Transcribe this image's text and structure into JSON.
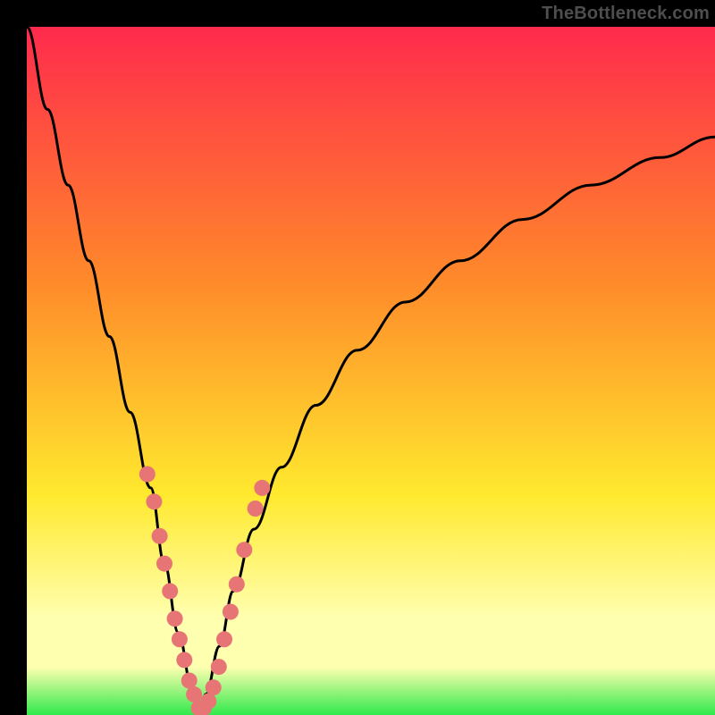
{
  "watermark": "TheBottleneck.com",
  "colors": {
    "frame_bg": "#000000",
    "gradient_top": "#ff2a4d",
    "gradient_mid1": "#ff8a2a",
    "gradient_mid2": "#ffe92e",
    "gradient_pale": "#ffffb0",
    "gradient_bottom": "#2fe94b",
    "curve_stroke": "#000000",
    "marker_fill": "#e77575"
  },
  "chart_data": {
    "type": "line",
    "title": "",
    "xlabel": "",
    "ylabel": "",
    "xlim": [
      0,
      100
    ],
    "ylim": [
      0,
      100
    ],
    "notes": "V-shaped bottleneck curve. y-axis is bottleneck percentage (0 at bottom = no bottleneck, 100 at top). Curve reaches minimum (~0%) near x≈25. Background gradient encodes severity: green near y=0, through yellow/orange, to red near y=100. No numeric axis ticks are shown on the image; values below are estimated from pixel positions.",
    "series": [
      {
        "name": "bottleneck-curve",
        "x": [
          0,
          3,
          6,
          9,
          12,
          15,
          18,
          20,
          22,
          24,
          25,
          26,
          28,
          30,
          33,
          37,
          42,
          48,
          55,
          63,
          72,
          82,
          92,
          100
        ],
        "y": [
          100,
          88,
          77,
          66,
          55,
          44,
          33,
          22,
          12,
          4,
          0,
          3,
          10,
          18,
          27,
          36,
          45,
          53,
          60,
          66,
          72,
          77,
          81,
          84
        ]
      }
    ],
    "markers": {
      "name": "highlighted-points",
      "comment": "Pink dot markers clustered on both arms of the V near the bottom (roughly y ≤ 35%).",
      "points": [
        {
          "x": 17.5,
          "y": 35
        },
        {
          "x": 18.5,
          "y": 31
        },
        {
          "x": 19.3,
          "y": 26
        },
        {
          "x": 20.0,
          "y": 22
        },
        {
          "x": 20.8,
          "y": 18
        },
        {
          "x": 21.5,
          "y": 14
        },
        {
          "x": 22.2,
          "y": 11
        },
        {
          "x": 22.9,
          "y": 8
        },
        {
          "x": 23.6,
          "y": 5
        },
        {
          "x": 24.3,
          "y": 3
        },
        {
          "x": 25.0,
          "y": 1
        },
        {
          "x": 25.7,
          "y": 1
        },
        {
          "x": 26.4,
          "y": 2
        },
        {
          "x": 27.1,
          "y": 4
        },
        {
          "x": 27.9,
          "y": 7
        },
        {
          "x": 28.7,
          "y": 11
        },
        {
          "x": 29.6,
          "y": 15
        },
        {
          "x": 30.5,
          "y": 19
        },
        {
          "x": 31.6,
          "y": 24
        },
        {
          "x": 33.2,
          "y": 30
        },
        {
          "x": 34.2,
          "y": 33
        }
      ]
    }
  }
}
